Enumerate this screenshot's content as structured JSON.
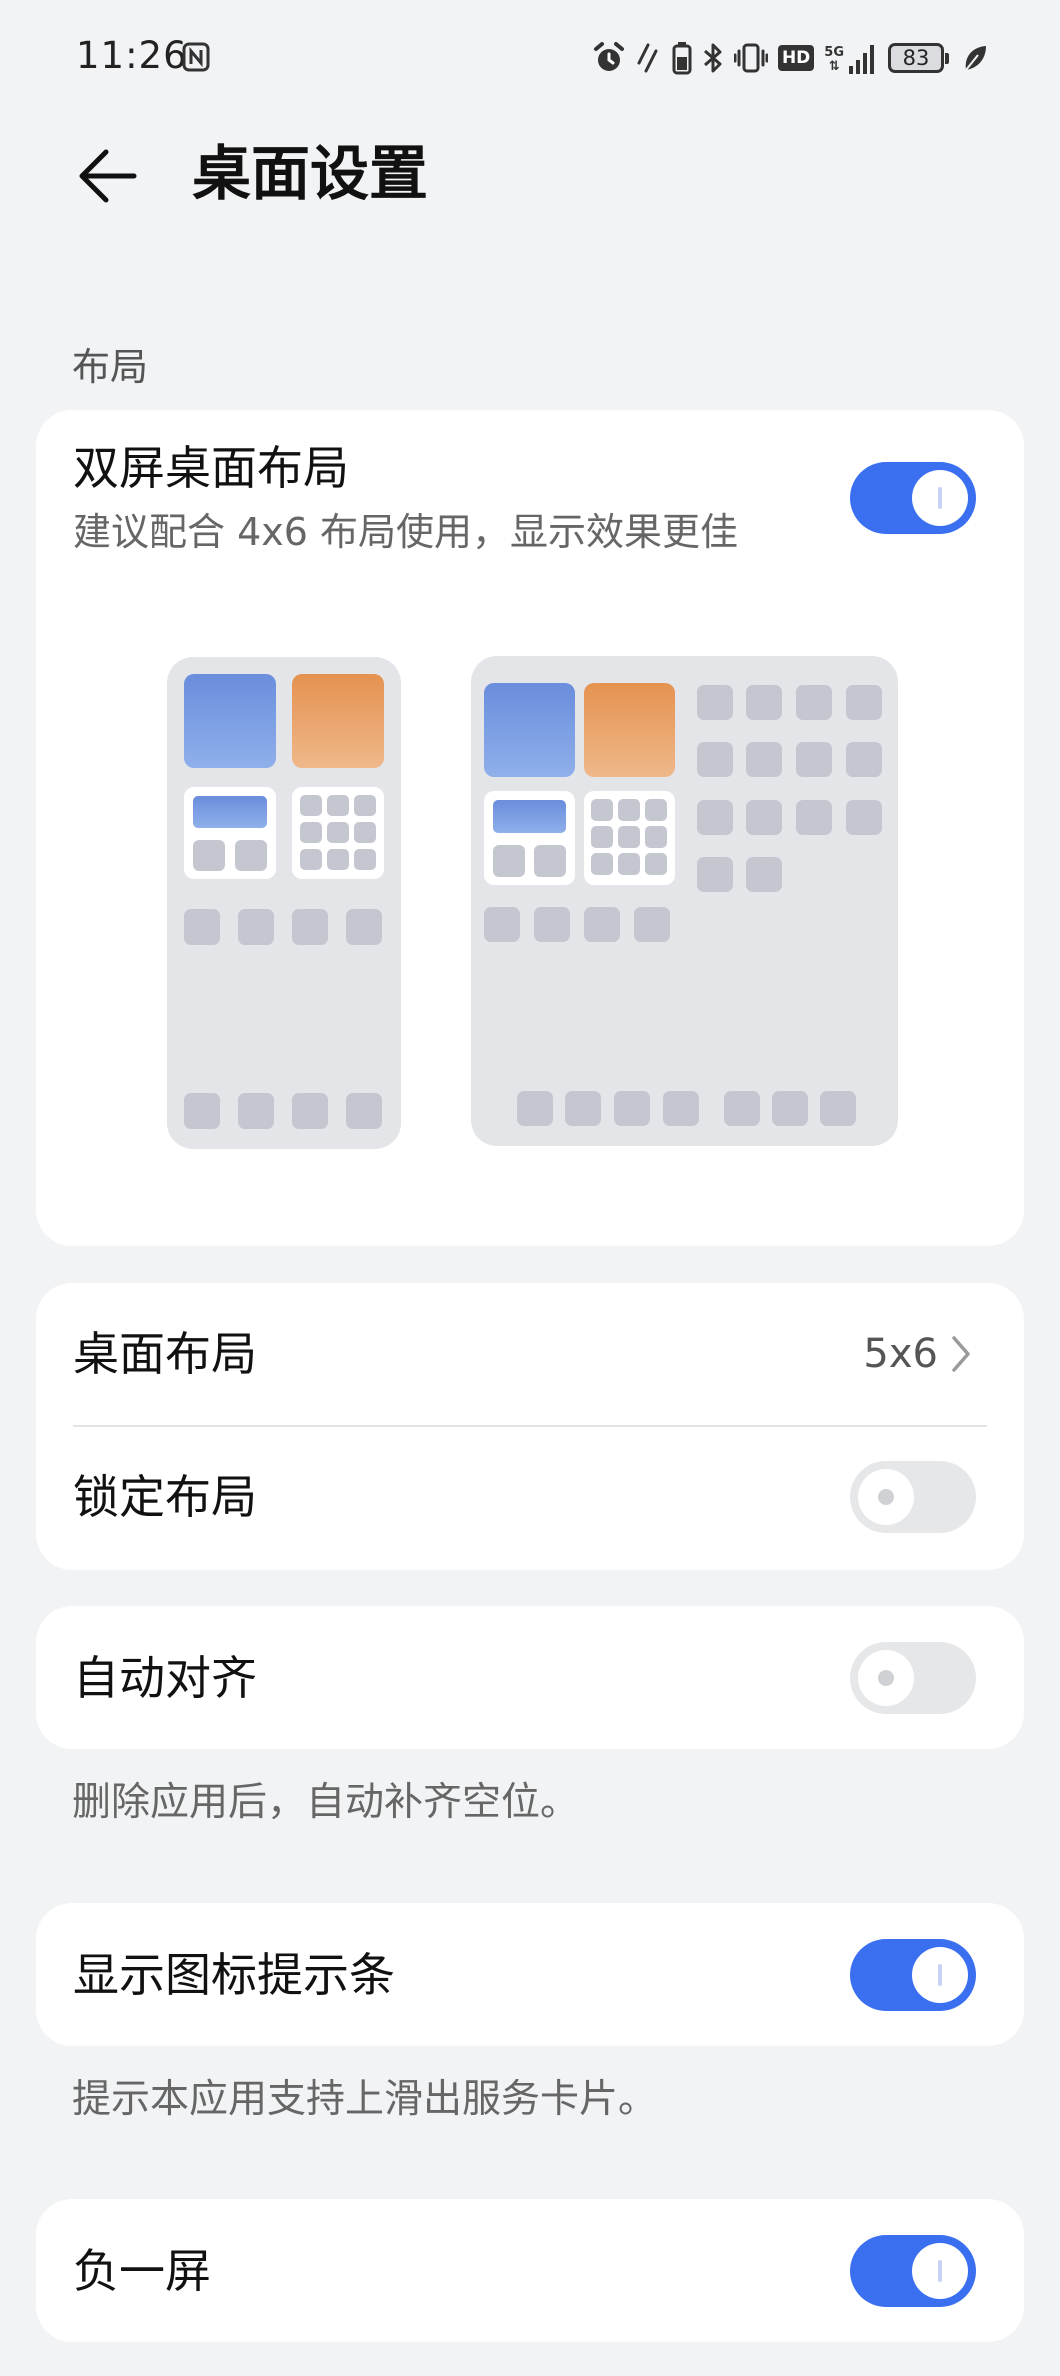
{
  "status_bar": {
    "time": "11:26",
    "battery": "83",
    "network": "5G"
  },
  "header": {
    "title": "桌面设置"
  },
  "layout_section": {
    "label": "布局",
    "dual_screen": {
      "title": "双屏桌面布局",
      "subtitle": "建议配合 4x6 布局使用，显示效果更佳",
      "enabled": true
    }
  },
  "desktop_layout": {
    "title": "桌面布局",
    "value": "5x6"
  },
  "lock_layout": {
    "title": "锁定布局",
    "enabled": false
  },
  "auto_align": {
    "title": "自动对齐",
    "enabled": false,
    "note": "删除应用后，自动补齐空位。"
  },
  "icon_hint_bar": {
    "title": "显示图标提示条",
    "enabled": true,
    "note": "提示本应用支持上滑出服务卡片。"
  },
  "minus_one_screen": {
    "title": "负一屏",
    "enabled": true
  },
  "colors": {
    "accent": "#3a6ff0",
    "background": "#f1f3f5",
    "card": "#ffffff",
    "preview_frame": "#e4e5e9",
    "preview_icon": "#c5c7d0",
    "widget_blue": "#6f95e0",
    "widget_orange": "#e8a064"
  }
}
